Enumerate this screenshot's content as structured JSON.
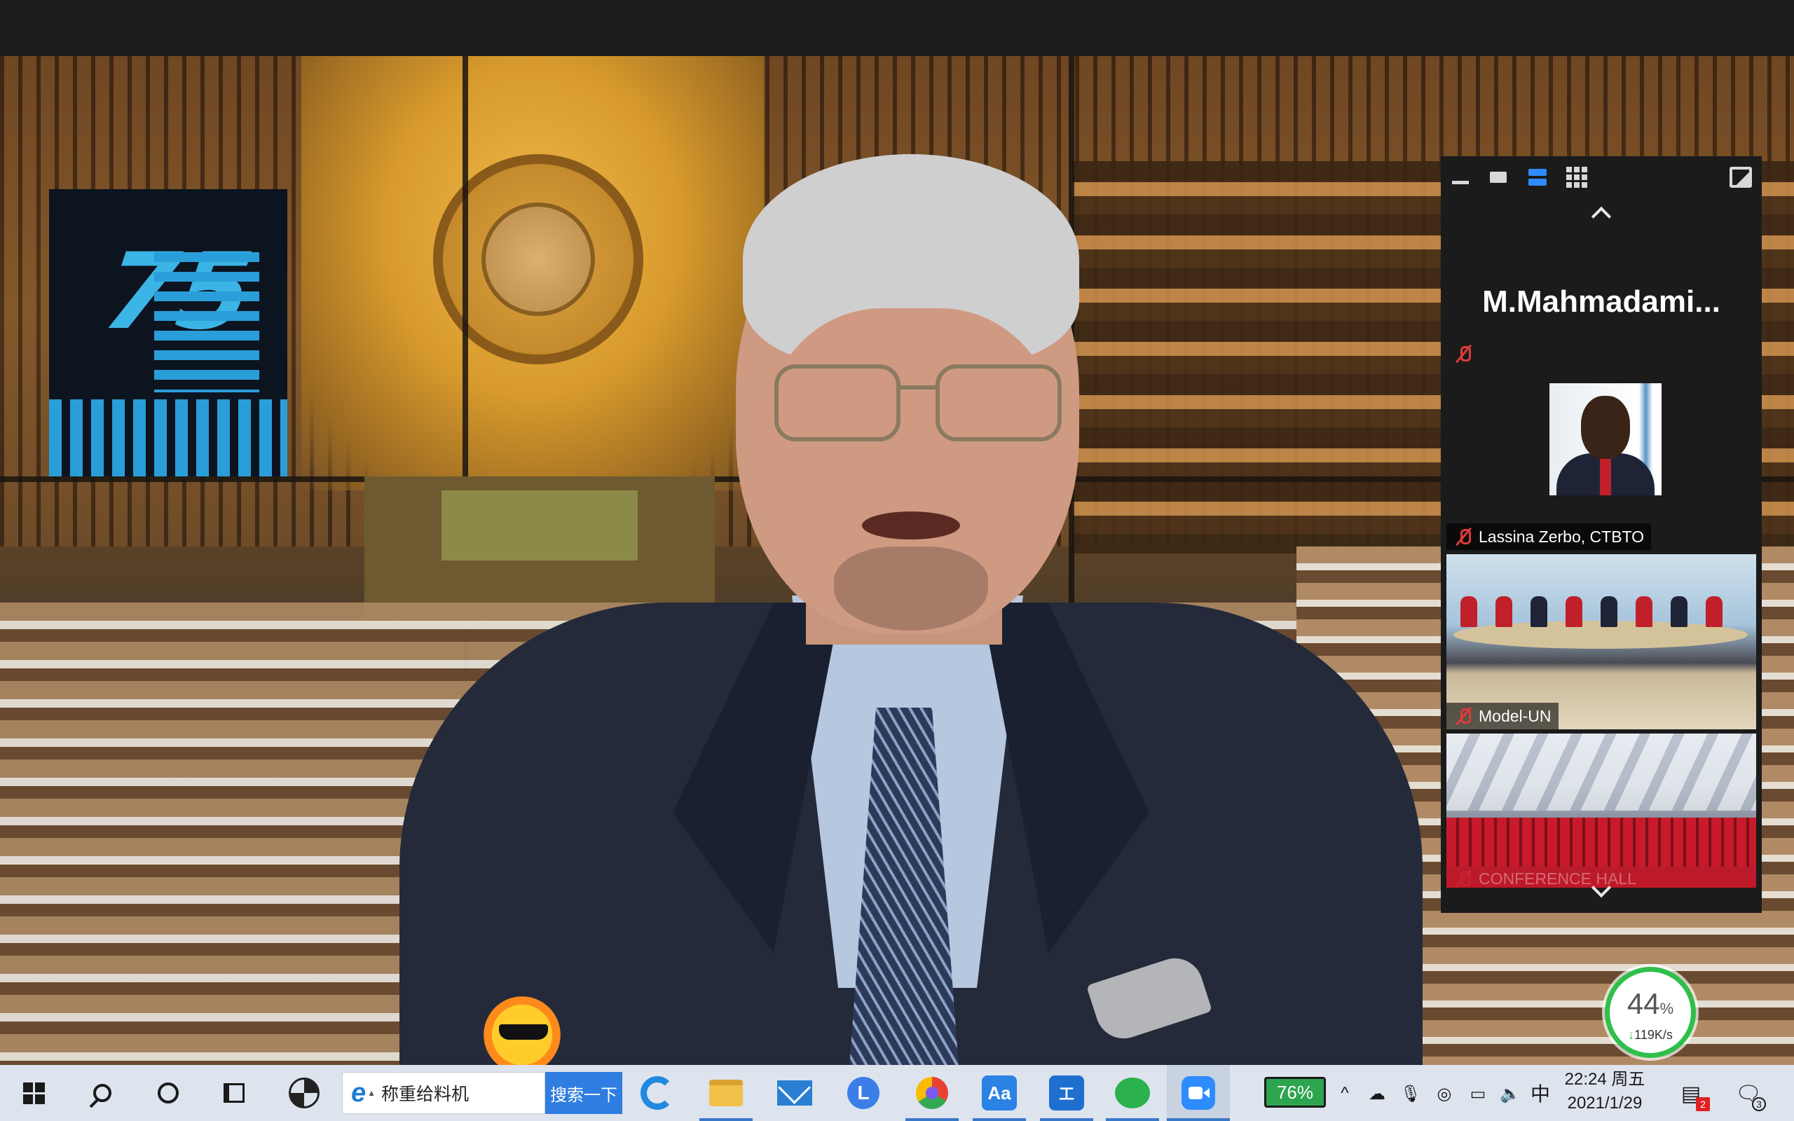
{
  "meeting": {
    "sidebar": {
      "featured_name": "M.Mahmadami...",
      "tiles": [
        {
          "name": "Lassina Zerbo, CTBTO",
          "muted": true
        },
        {
          "name": "Model-UN",
          "muted": true
        },
        {
          "name": "CONFERENCE HALL",
          "muted": true
        }
      ]
    }
  },
  "taskbar": {
    "ie_text": "称重给料机",
    "search_button": "搜索一下",
    "battery_percent": "76%",
    "ime": "中",
    "time": "22:24 周五",
    "date": "2021/1/29",
    "notification_count_1": "2",
    "notification_count_2": "3"
  },
  "speed_widget": {
    "percent": "44",
    "percent_sign": "%",
    "rate": "119K/s"
  },
  "icons": [
    "windows-start-icon",
    "search-icon",
    "cortana-icon",
    "task-view-icon",
    "pinwheel-icon",
    "ie-icon",
    "edge-icon",
    "file-explorer-icon",
    "mail-icon",
    "clock-app-icon",
    "photos-icon",
    "dictionary-icon",
    "pen-icon",
    "wechat-icon",
    "zoom-icon",
    "onedrive-icon",
    "microphone-icon",
    "battery-icon",
    "volume-icon",
    "chevron-up-icon"
  ],
  "colors": {
    "zoom_blue": "#2d8cff",
    "muted_red": "#e03a3a",
    "battery_green": "#2da44e",
    "taskbar_bg": "#dde4ee"
  }
}
